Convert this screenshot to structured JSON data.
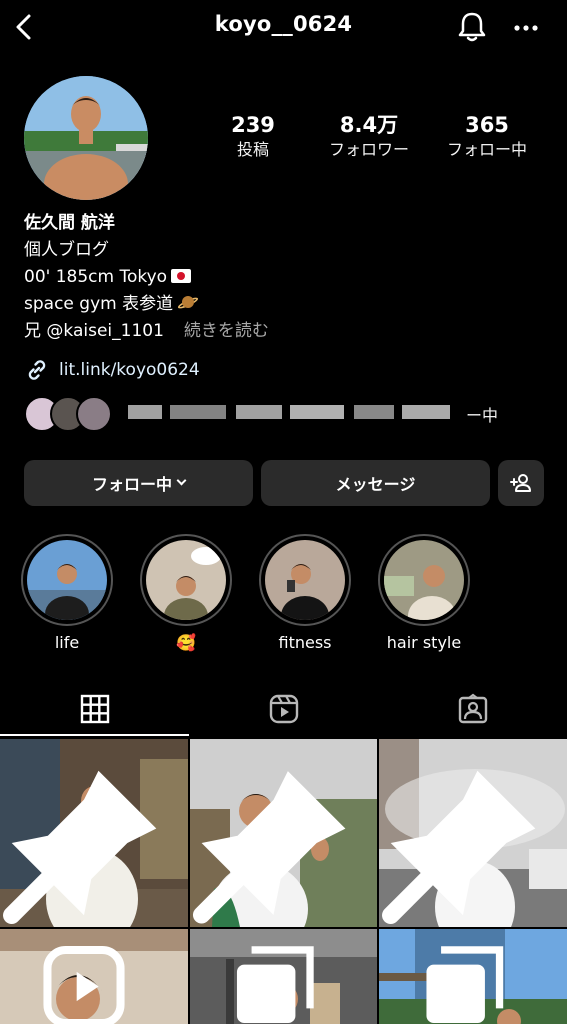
{
  "header": {
    "username": "koyo__0624",
    "back_icon": "chevron-left-icon",
    "bell_icon": "bell-icon",
    "more_icon": "more-horizontal-icon"
  },
  "stats": {
    "posts": {
      "value": "239",
      "label": "投稿"
    },
    "followers": {
      "value": "8.4万",
      "label": "フォロワー"
    },
    "following": {
      "value": "365",
      "label": "フォロー中"
    }
  },
  "bio": {
    "name": "佐久間 航洋",
    "category": "個人ブログ",
    "line1": "00' 185cm Tokyo",
    "line2": "space gym 表参道",
    "line3": "兄 @kaisei_1101",
    "read_more": "続きを読む",
    "link": "lit.link/koyo0624",
    "followed_by_suffix": "ー中"
  },
  "buttons": {
    "following": "フォロー中",
    "message": "メッセージ",
    "add_user_icon": "add-person-icon"
  },
  "highlights": [
    {
      "label": "life"
    },
    {
      "label": "🥰"
    },
    {
      "label": "fitness"
    },
    {
      "label": "hair style"
    }
  ],
  "tabs": [
    "grid-icon",
    "reels-icon",
    "tagged-icon"
  ],
  "colors": {
    "background": "#000000",
    "button": "#2b2b2b",
    "link": "#e0f1ff",
    "secondary_text": "#a8a8a8"
  }
}
